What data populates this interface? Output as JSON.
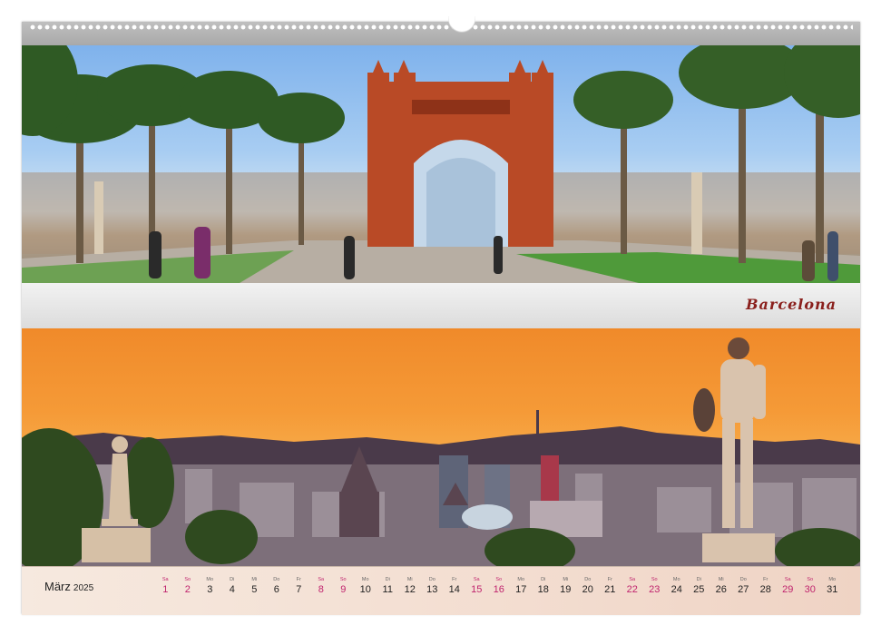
{
  "caption": "Barcelona",
  "calendar": {
    "month": "März",
    "year": "2025",
    "days": [
      {
        "dow": "Sa",
        "num": "1",
        "weekend": true
      },
      {
        "dow": "So",
        "num": "2",
        "weekend": true
      },
      {
        "dow": "Mo",
        "num": "3",
        "weekend": false
      },
      {
        "dow": "Di",
        "num": "4",
        "weekend": false
      },
      {
        "dow": "Mi",
        "num": "5",
        "weekend": false
      },
      {
        "dow": "Do",
        "num": "6",
        "weekend": false
      },
      {
        "dow": "Fr",
        "num": "7",
        "weekend": false
      },
      {
        "dow": "Sa",
        "num": "8",
        "weekend": true
      },
      {
        "dow": "So",
        "num": "9",
        "weekend": true
      },
      {
        "dow": "Mo",
        "num": "10",
        "weekend": false
      },
      {
        "dow": "Di",
        "num": "11",
        "weekend": false
      },
      {
        "dow": "Mi",
        "num": "12",
        "weekend": false
      },
      {
        "dow": "Do",
        "num": "13",
        "weekend": false
      },
      {
        "dow": "Fr",
        "num": "14",
        "weekend": false
      },
      {
        "dow": "Sa",
        "num": "15",
        "weekend": true
      },
      {
        "dow": "So",
        "num": "16",
        "weekend": true
      },
      {
        "dow": "Mo",
        "num": "17",
        "weekend": false
      },
      {
        "dow": "Di",
        "num": "18",
        "weekend": false
      },
      {
        "dow": "Mi",
        "num": "19",
        "weekend": false
      },
      {
        "dow": "Do",
        "num": "20",
        "weekend": false
      },
      {
        "dow": "Fr",
        "num": "21",
        "weekend": false
      },
      {
        "dow": "Sa",
        "num": "22",
        "weekend": true
      },
      {
        "dow": "So",
        "num": "23",
        "weekend": true
      },
      {
        "dow": "Mo",
        "num": "24",
        "weekend": false
      },
      {
        "dow": "Di",
        "num": "25",
        "weekend": false
      },
      {
        "dow": "Mi",
        "num": "26",
        "weekend": false
      },
      {
        "dow": "Do",
        "num": "27",
        "weekend": false
      },
      {
        "dow": "Fr",
        "num": "28",
        "weekend": false
      },
      {
        "dow": "Sa",
        "num": "29",
        "weekend": true
      },
      {
        "dow": "So",
        "num": "30",
        "weekend": true
      },
      {
        "dow": "Mo",
        "num": "31",
        "weekend": false
      }
    ]
  },
  "colors": {
    "weekend": "#c0246e",
    "caption": "#8a1f1c",
    "arch_brick": "#b94a26"
  }
}
